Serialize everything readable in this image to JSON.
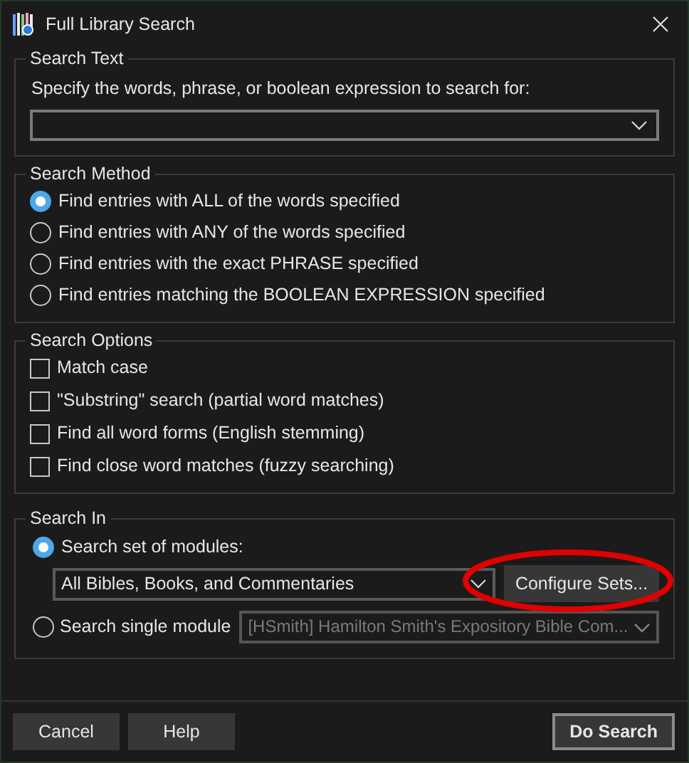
{
  "window": {
    "title": "Full Library Search"
  },
  "search_text": {
    "legend": "Search Text",
    "prompt": "Specify the words, phrase, or boolean expression to search for:"
  },
  "search_method": {
    "legend": "Search Method",
    "options": [
      {
        "label": "Find entries with ALL of the words specified",
        "selected": true
      },
      {
        "label": "Find entries with ANY of the words specified",
        "selected": false
      },
      {
        "label": "Find entries with the exact PHRASE specified",
        "selected": false
      },
      {
        "label": "Find entries matching the BOOLEAN EXPRESSION specified",
        "selected": false
      }
    ]
  },
  "search_options": {
    "legend": "Search Options",
    "options": [
      {
        "label": "Match case",
        "checked": false
      },
      {
        "label": "\"Substring\" search (partial word matches)",
        "checked": false
      },
      {
        "label": "Find all word forms (English stemming)",
        "checked": false
      },
      {
        "label": "Find close word matches (fuzzy searching)",
        "checked": false
      }
    ]
  },
  "search_in": {
    "legend": "Search In",
    "set": {
      "label": "Search set of modules:",
      "selected": true,
      "value": "All Bibles, Books, and Commentaries",
      "disabled": false
    },
    "configure_button": {
      "label": "Configure Sets...",
      "circled": true
    },
    "single": {
      "label": "Search single module",
      "selected": false,
      "value": "[HSmith] Hamilton Smith's Expository Bible Com...",
      "disabled": true
    }
  },
  "buttons": {
    "cancel": "Cancel",
    "help": "Help",
    "search": "Do Search"
  }
}
